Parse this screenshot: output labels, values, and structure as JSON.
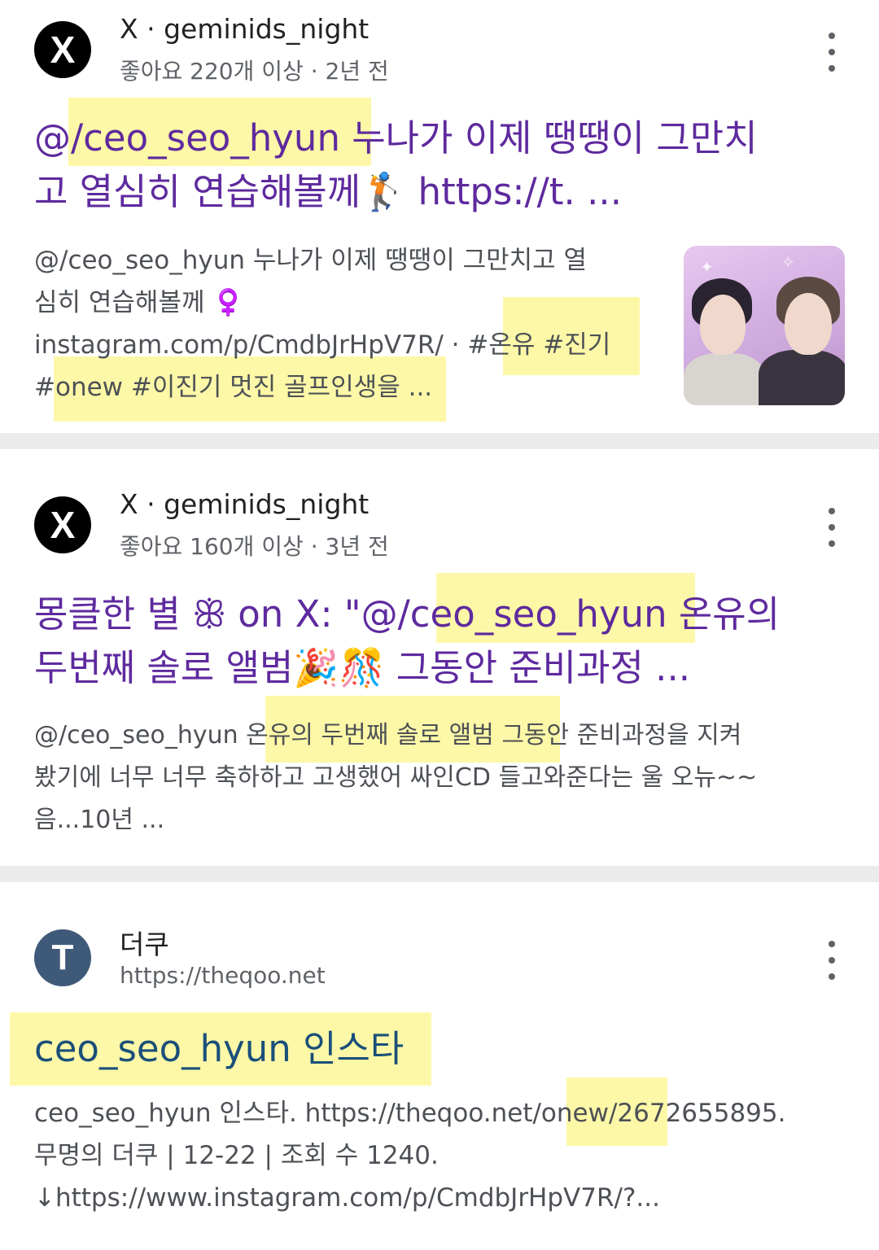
{
  "results": [
    {
      "favicon_letter": "X",
      "site": "X · geminids_night",
      "meta": "좋아요 220개 이상 · 2년 전",
      "title_lines": [
        "@/ceo_seo_hyun 누나가 이제 땡땡이 그만치",
        "고 열심히 연습해볼께🏌 https://t. ..."
      ],
      "snippet_lines": [
        "@/ceo_seo_hyun 누나가 이제 땡땡이 그만치고 열",
        "심히 연습해볼께 ♀️",
        "instagram.com/p/CmdbJrHpV7R/ · #온유 #진기",
        "#onew #이진기 멋진 골프인생을 ..."
      ]
    },
    {
      "favicon_letter": "X",
      "site": "X · geminids_night",
      "meta": "좋아요 160개 이상 · 3년 전",
      "title_lines": [
        "몽클한 별 ꕥ on X: \"@/ceo_seo_hyun 온유의",
        "두번째 솔로 앨범🎉🎊 그동안 준비과정 ..."
      ],
      "snippet_lines": [
        "@/ceo_seo_hyun 온유의 두번째 솔로 앨범 그동안 준비과정을 지켜",
        "봤기에 너무 너무 축하하고 고생했어 싸인CD 들고와준다는 울 오뉴~~",
        "음...10년 ..."
      ]
    },
    {
      "favicon_letter": "T",
      "site": "더쿠",
      "meta": "https://theqoo.net",
      "title_lines": [
        "ceo_seo_hyun 인스타"
      ],
      "snippet_lines": [
        "ceo_seo_hyun 인스타. https://theqoo.net/onew/2672655895.",
        "무명의 더쿠 | 12-22 | 조회 수 1240.",
        "↓https://www.instagram.com/p/CmdbJrHpV7R/?..."
      ]
    }
  ],
  "icons": {
    "favicon_x": "x-logo-icon",
    "favicon_t": "theqoo-logo-icon",
    "more": "more-vert-icon",
    "thumbnail": "result-thumbnail-image"
  },
  "colors": {
    "title_visited": "#5e2a9e",
    "title_link": "#1a4f7a",
    "highlight": "#fcf68a",
    "divider": "#ebebeb"
  }
}
